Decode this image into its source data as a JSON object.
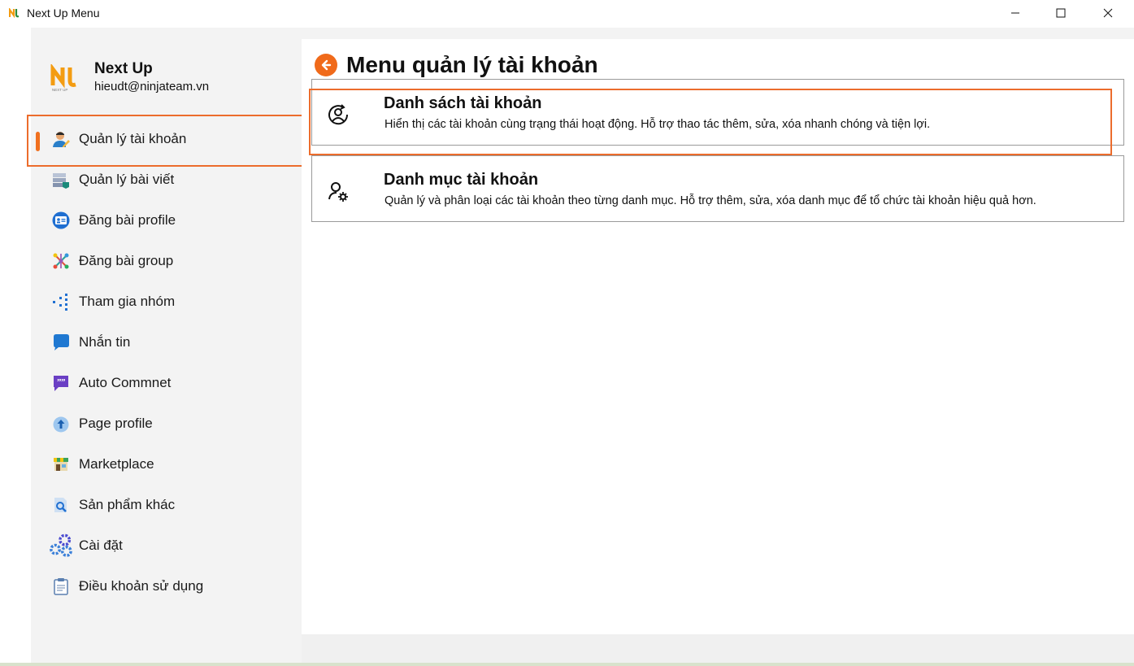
{
  "window": {
    "title": "Next Up Menu",
    "controls": {
      "minimize_icon": "minimize-icon",
      "maximize_icon": "maximize-icon",
      "close_icon": "close-icon"
    }
  },
  "brand": {
    "name": "Next Up",
    "email": "hieudt@ninjateam.vn",
    "logo_small_text": "NEXT UP"
  },
  "sidebar": {
    "items": [
      {
        "label": "Quản lý tài khoản",
        "icon": "user-edit-icon",
        "active": true
      },
      {
        "label": "Quản lý bài viết",
        "icon": "stack-icon",
        "active": false
      },
      {
        "label": "Đăng bài profile",
        "icon": "id-card-icon",
        "active": false
      },
      {
        "label": "Đăng bài group",
        "icon": "network-icon",
        "active": false
      },
      {
        "label": "Tham gia nhóm",
        "icon": "dots-icon",
        "active": false
      },
      {
        "label": "Nhắn tin",
        "icon": "chat-icon",
        "active": false
      },
      {
        "label": "Auto Commnet",
        "icon": "quote-icon",
        "active": false
      },
      {
        "label": "Page profile",
        "icon": "upload-icon",
        "active": false
      },
      {
        "label": "Marketplace",
        "icon": "store-icon",
        "active": false
      },
      {
        "label": "Sản phẩm khác",
        "icon": "doc-search-icon",
        "active": false
      },
      {
        "label": "Cài đặt",
        "icon": "gears-icon",
        "active": false
      },
      {
        "label": "Điều khoản sử dụng",
        "icon": "clipboard-icon",
        "active": false
      }
    ]
  },
  "main": {
    "title": "Menu quản lý tài khoản",
    "cards": [
      {
        "title": "Danh sách tài khoản",
        "description": "Hiển thị các tài khoản cùng trạng thái hoạt động. Hỗ trợ thao tác thêm, sửa, xóa nhanh chóng và tiện lợi.",
        "icon": "user-refresh-icon"
      },
      {
        "title": "Danh mục tài khoản",
        "description": "Quản lý và phân loại các tài khoản theo từng danh mục. Hỗ trợ thêm, sửa, xóa danh mục để tổ chức tài khoản hiệu quả hơn.",
        "icon": "user-settings-icon"
      }
    ]
  },
  "colors": {
    "accent": "#f06a1a",
    "highlight_border": "#ec6c2c",
    "sidebar_bg": "#f3f3f3"
  }
}
